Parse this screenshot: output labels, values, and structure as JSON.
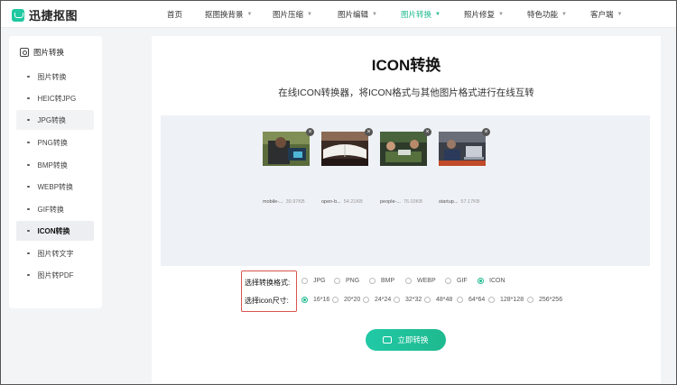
{
  "app": {
    "logo_text": "迅捷抠图",
    "brand_color": "#1fb98e"
  },
  "nav": [
    {
      "label": "首页",
      "chevron": false,
      "active": false
    },
    {
      "label": "抠图换背景",
      "chevron": true,
      "active": false
    },
    {
      "label": "图片压缩",
      "chevron": true,
      "active": false
    },
    {
      "label": "图片编辑",
      "chevron": true,
      "active": false
    },
    {
      "label": "图片转换",
      "chevron": true,
      "active": true
    },
    {
      "label": "照片修复",
      "chevron": true,
      "active": false
    },
    {
      "label": "特色功能",
      "chevron": true,
      "active": false
    },
    {
      "label": "客户端",
      "chevron": true,
      "active": false
    }
  ],
  "sidebar": {
    "heading": "图片转换",
    "items": [
      {
        "label": "图片转换"
      },
      {
        "label": "HEIC转JPG"
      },
      {
        "label": "JPG转换"
      },
      {
        "label": "PNG转换"
      },
      {
        "label": "BMP转换"
      },
      {
        "label": "WEBP转换"
      },
      {
        "label": "GIF转换"
      },
      {
        "label": "ICON转换"
      },
      {
        "label": "图片转文字"
      },
      {
        "label": "图片转PDF"
      }
    ],
    "active_item": "ICON转换"
  },
  "main": {
    "title": "ICON转换",
    "subtitle": "在线ICON转换器，将ICON格式与其他图片格式进行在线互转",
    "files": [
      {
        "name": "mobile-...",
        "size": "39.97KB",
        "icon": "close-icon"
      },
      {
        "name": "open-b...",
        "size": "54.21KB",
        "icon": "close-icon"
      },
      {
        "name": "people-...",
        "size": "76.03KB",
        "icon": "close-icon"
      },
      {
        "name": "startup...",
        "size": "57.17KB",
        "icon": "close-icon"
      }
    ],
    "format_label": "选择转换格式:",
    "formats": [
      "JPG",
      "PNG",
      "BMP",
      "WEBP",
      "GIF",
      "ICON"
    ],
    "selected_format": "ICON",
    "size_label": "选择icon尺寸:",
    "sizes": [
      "16*16",
      "20*20",
      "24*24",
      "32*32",
      "48*48",
      "64*64",
      "128*128",
      "256*256"
    ],
    "selected_size": "16*16",
    "convert_button": "立即转换"
  }
}
